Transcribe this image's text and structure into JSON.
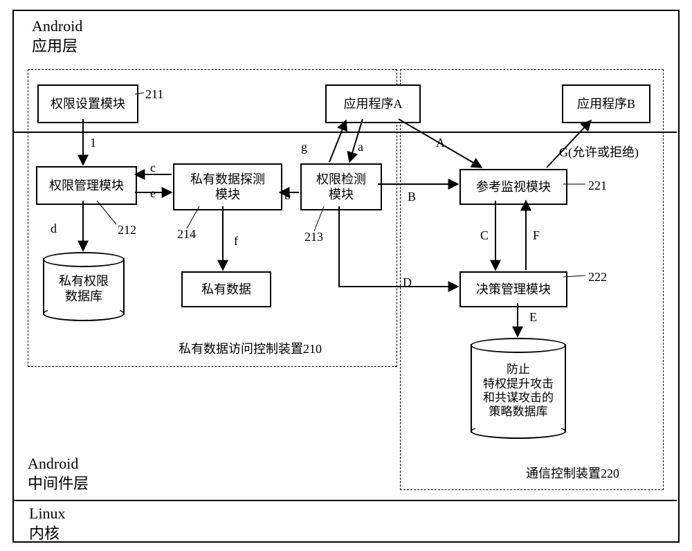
{
  "layers": {
    "android_app": "Android\n应用层",
    "android_mid": "Android\n中间件层",
    "linux": "Linux\n内核"
  },
  "boxes": {
    "perm_set": "权限设置模块",
    "app_a": "应用程序A",
    "app_b": "应用程序B",
    "perm_mgmt": "权限管理模块",
    "priv_detect": "私有数据探测\n模块",
    "perm_check": "权限检测\n模块",
    "ref_monitor": "参考监视模块",
    "priv_data": "私有数据",
    "policy_mgmt": "决策管理模块"
  },
  "db": {
    "priv_db": "私有权限\n数据库",
    "policy_db": "防止\n特权提升攻击\n和共谋攻击的\n策略数据库"
  },
  "edge": {
    "l1": "1",
    "a": "a",
    "b": "b",
    "c": "c",
    "d": "d",
    "e": "e",
    "f": "f",
    "g": "g",
    "A": "A",
    "B": "B",
    "C": "C",
    "D": "D",
    "E": "E",
    "F": "F",
    "G": "G(允许或拒绝)"
  },
  "dev": {
    "priv_dev": "私有数据访问控制装置210",
    "comm_dev": "通信控制装置220"
  },
  "num": {
    "n211": "211",
    "n212": "212",
    "n213": "213",
    "n214": "214",
    "n221": "221",
    "n222": "222"
  }
}
